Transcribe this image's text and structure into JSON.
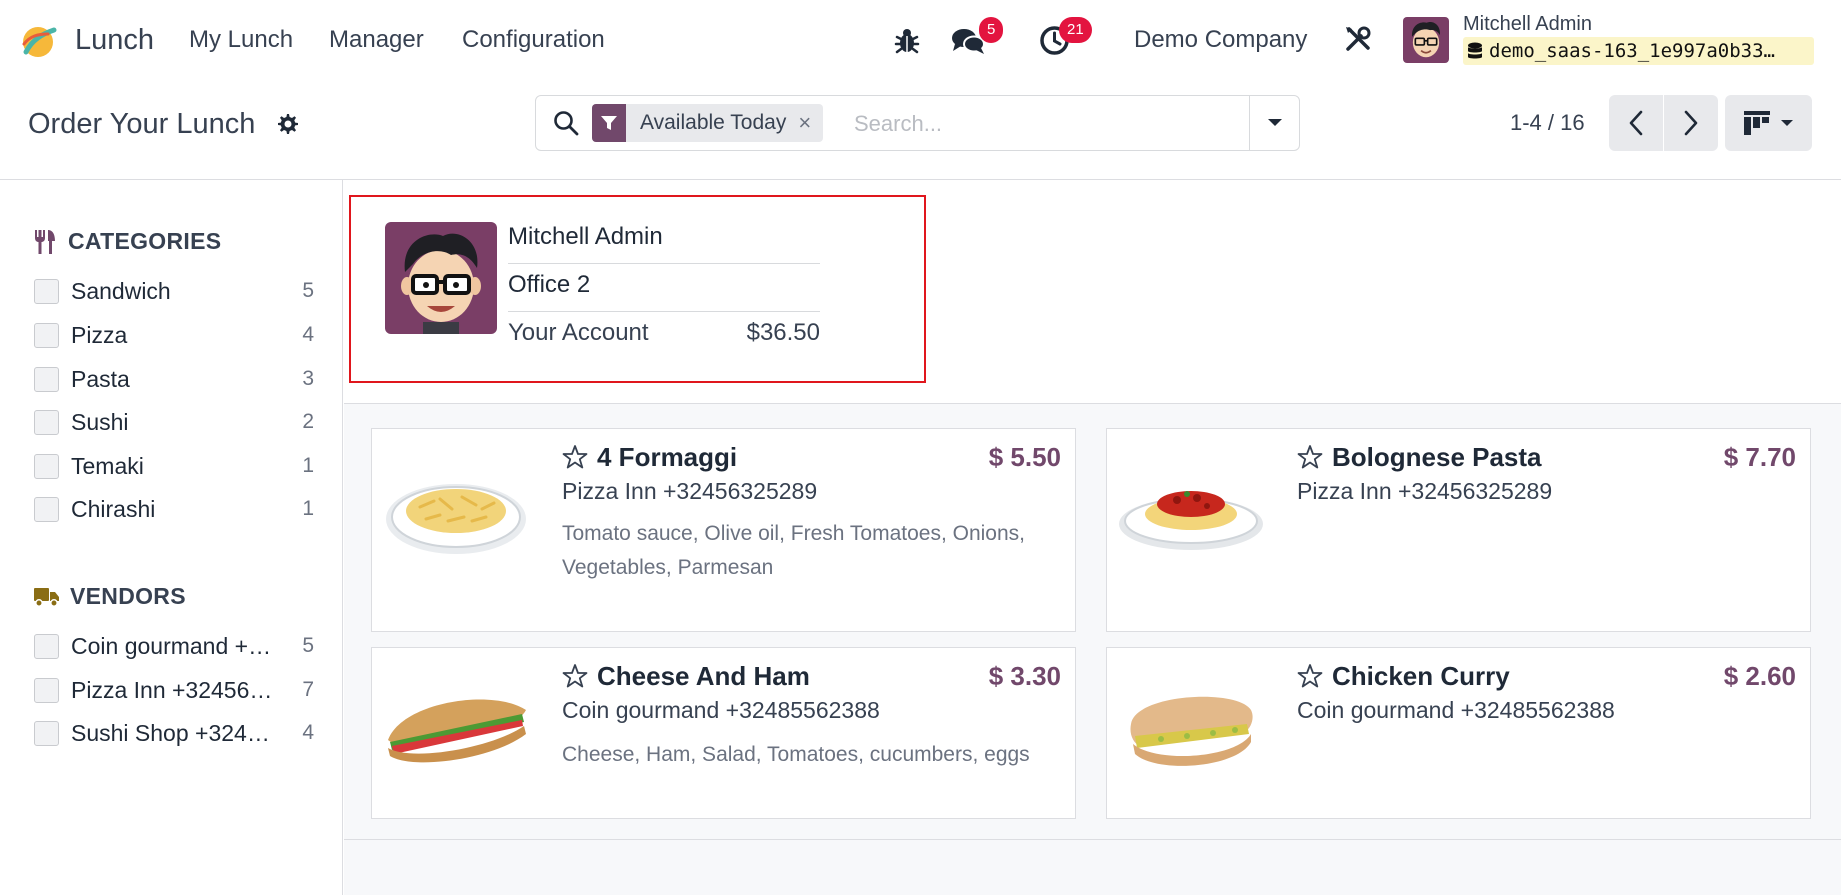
{
  "navbar": {
    "app_name": "Lunch",
    "menu": [
      "My Lunch",
      "Manager",
      "Configuration"
    ],
    "messages_count": "5",
    "activities_count": "21",
    "company": "Demo Company",
    "user_name": "Mitchell Admin",
    "database": "demo_saas-163_1e997a0b33…"
  },
  "control_panel": {
    "title": "Order Your Lunch",
    "facet_label": "Available Today",
    "facet_close": "×",
    "search_placeholder": "Search...",
    "pager_value": "1-4 / 16"
  },
  "sidebar": {
    "categories": {
      "title": "CATEGORIES",
      "items": [
        {
          "label": "Sandwich",
          "count": "5"
        },
        {
          "label": "Pizza",
          "count": "4"
        },
        {
          "label": "Pasta",
          "count": "3"
        },
        {
          "label": "Sushi",
          "count": "2"
        },
        {
          "label": "Temaki",
          "count": "1"
        },
        {
          "label": "Chirashi",
          "count": "1"
        }
      ]
    },
    "vendors": {
      "title": "VENDORS",
      "items": [
        {
          "label": "Coin gourmand +…",
          "count": "5"
        },
        {
          "label": "Pizza Inn +32456…",
          "count": "7"
        },
        {
          "label": "Sushi Shop +324…",
          "count": "4"
        }
      ]
    }
  },
  "user_panel": {
    "name": "Mitchell Admin",
    "location": "Office 2",
    "account_label": "Your Account",
    "account_value": "$36.50"
  },
  "products": [
    {
      "name": "4 Formaggi",
      "price": "$ 5.50",
      "vendor": "Pizza Inn +32456325289",
      "description": "Tomato sauce, Olive oil, Fresh Tomatoes, Onions, Vegetables, Parmesan"
    },
    {
      "name": "Bolognese Pasta",
      "price": "$ 7.70",
      "vendor": "Pizza Inn +32456325289",
      "description": ""
    },
    {
      "name": "Cheese And Ham",
      "price": "$ 3.30",
      "vendor": "Coin gourmand +32485562388",
      "description": "Cheese, Ham, Salad, Tomatoes, cucumbers, eggs"
    },
    {
      "name": "Chicken Curry",
      "price": "$ 2.60",
      "vendor": "Coin gourmand +32485562388",
      "description": ""
    }
  ],
  "colors": {
    "brand": "#71486b",
    "badge": "#e3143f",
    "highlight": "#e0161d"
  },
  "icons": [
    "app-logo-icon",
    "bug-icon",
    "chat-icon",
    "clock-icon",
    "tools-icon",
    "database-icon",
    "gear-icon",
    "search-icon",
    "filter-icon",
    "caret-down-icon",
    "chevron-left-icon",
    "chevron-right-icon",
    "kanban-view-icon",
    "cutlery-icon",
    "truck-icon",
    "star-icon"
  ]
}
